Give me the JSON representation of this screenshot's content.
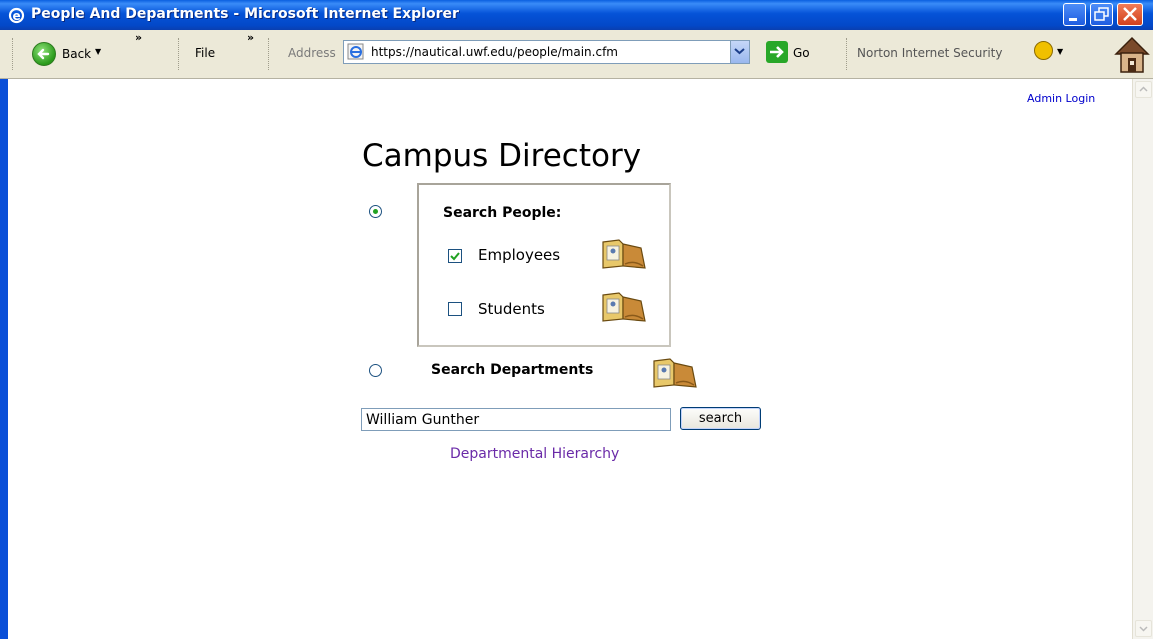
{
  "window": {
    "title": "People And Departments - Microsoft Internet Explorer"
  },
  "toolbar": {
    "back_label": "Back",
    "file_menu": "File",
    "address_label": "Address",
    "address_url": "https://nautical.uwf.edu/people/main.cfm",
    "go_label": "Go",
    "norton_label": "Norton Internet Security"
  },
  "page": {
    "admin_login": "Admin Login",
    "title": "Campus Directory",
    "search_people_label": "Search People:",
    "employees_label": "Employees",
    "students_label": "Students",
    "search_departments_label": "Search Departments",
    "search_value": "William Gunther",
    "search_button": "search",
    "dept_hierarchy_link": "Departmental Hierarchy"
  },
  "state": {
    "search_people_selected": true,
    "employees_checked": true,
    "students_checked": false
  },
  "colors": {
    "titlebar": "#0553d8",
    "link_visited": "#6a2aa8",
    "link": "#0000cc"
  }
}
